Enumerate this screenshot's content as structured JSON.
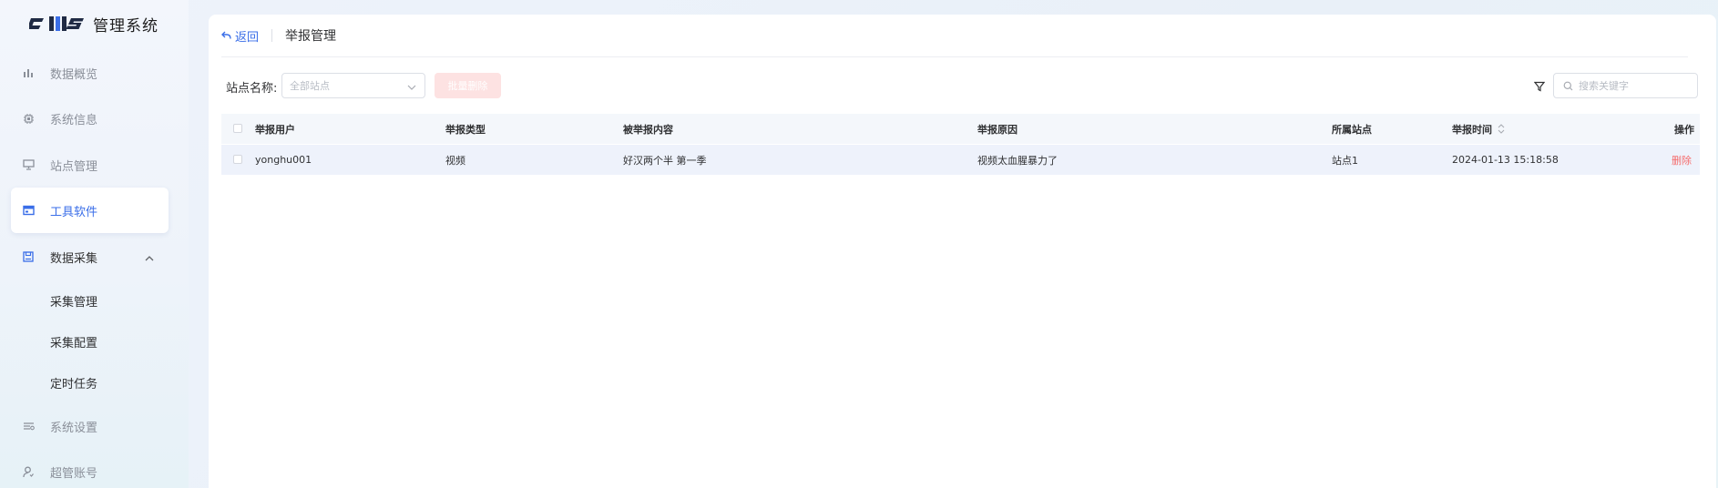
{
  "app": {
    "logo_text": "管理系统",
    "logo_mark": "CMS"
  },
  "sidebar": {
    "items": [
      {
        "label": "数据概览",
        "icon": "bar-chart-icon"
      },
      {
        "label": "系统信息",
        "icon": "chip-icon"
      },
      {
        "label": "站点管理",
        "icon": "monitor-icon"
      },
      {
        "label": "工具软件",
        "icon": "window-icon",
        "active": true
      },
      {
        "label": "数据采集",
        "icon": "save-icon",
        "expanded": true
      },
      {
        "label": "系统设置",
        "icon": "sliders-icon"
      },
      {
        "label": "超管账号",
        "icon": "user-icon"
      }
    ],
    "sub_items": [
      {
        "label": "采集管理"
      },
      {
        "label": "采集配置"
      },
      {
        "label": "定时任务"
      }
    ]
  },
  "header": {
    "back_label": "返回",
    "title": "举报管理"
  },
  "toolbar": {
    "site_filter_label": "站点名称:",
    "site_select_placeholder": "全部站点",
    "batch_delete_label": "批量删除",
    "search_placeholder": "搜索关键字"
  },
  "table": {
    "columns": [
      "举报用户",
      "举报类型",
      "被举报内容",
      "举报原因",
      "所属站点",
      "举报时间",
      "操作"
    ],
    "rows": [
      {
        "user": "yonghu001",
        "type": "视频",
        "content": "好汉两个半 第一季",
        "reason": "视频太血腥暴力了",
        "site": "站点1",
        "time": "2024-01-13 15:18:58",
        "action": "删除"
      }
    ]
  },
  "colors": {
    "accent": "#3a6ee8",
    "danger": "#f56c6c",
    "danger_light": "#fde2e2"
  }
}
